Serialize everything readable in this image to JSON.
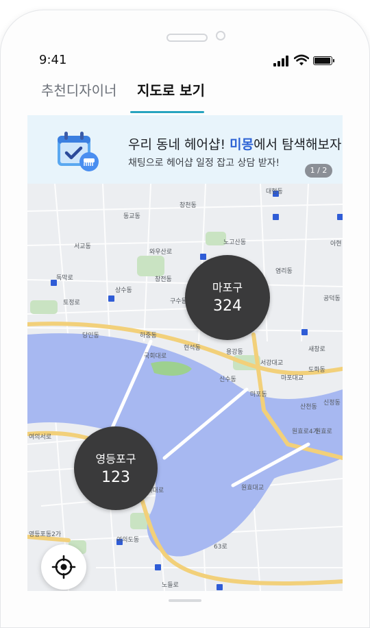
{
  "status_bar": {
    "time": "9:41"
  },
  "tabs": [
    {
      "label": "추천디자이너",
      "active": false
    },
    {
      "label": "지도로 보기",
      "active": true
    }
  ],
  "banner": {
    "title_prefix": "우리 동네 헤어샵! ",
    "title_highlight": "미몽",
    "title_suffix": "에서 탐색해보자",
    "subtitle": "채팅으로 헤어샵 일정 잡고 상담 받자!",
    "page_indicator": "1 / 2"
  },
  "map": {
    "labels": [
      "창천동",
      "서교동",
      "동교동",
      "와우산로",
      "창전동",
      "노고산동",
      "대현동",
      "염리동",
      "공덕동",
      "상수동",
      "토정로",
      "구수동",
      "당인동",
      "하중동",
      "현석동",
      "용강동",
      "도화동",
      "마포동",
      "신수동",
      "새창로",
      "산천동",
      "신정동",
      "원효로4가",
      "여의서로",
      "여의도동",
      "여의대로",
      "영등포동2가",
      "63로",
      "노들로",
      "국회대로",
      "원효대교",
      "서강대교",
      "마포대교",
      "원효로",
      "독막로",
      "아현"
    ],
    "clusters": [
      {
        "name": "마포구",
        "count": "324"
      },
      {
        "name": "영등포구",
        "count": "123"
      }
    ]
  },
  "colors": {
    "accent": "#27a3bf",
    "highlight": "#2d63d5",
    "banner_bg": "#e8f4fb",
    "river": "#a7b8f1",
    "cluster_bg": "#3a3a3b"
  }
}
